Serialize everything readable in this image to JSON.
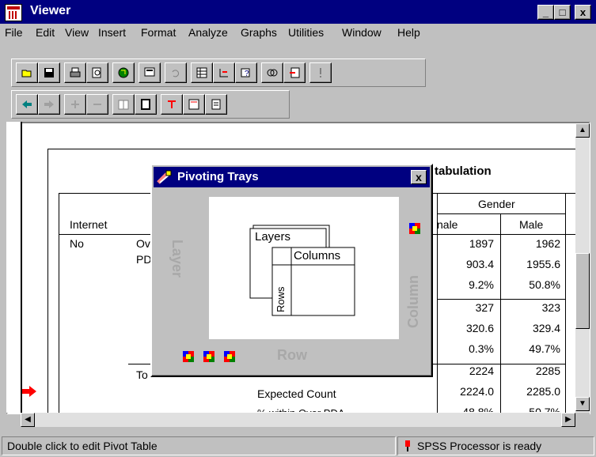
{
  "window": {
    "title": "Viewer",
    "minimize": "_",
    "maximize": "□",
    "close": "x"
  },
  "menu": [
    "File",
    "Edit",
    "View",
    "Insert",
    "Format",
    "Analyze",
    "Graphs",
    "Utilities",
    "Window",
    "Help"
  ],
  "table": {
    "title_partial": "tabulation",
    "header_gender": "Gender",
    "col_female_partial": "nale",
    "col_male": "Male",
    "row_var": "Internet",
    "row_no": "No",
    "row_sub1_a": "Ov",
    "row_sub1_b": "PD",
    "row_total_partial": "To",
    "expected_count": "Expected Count",
    "partial_row": "% within Over PDA",
    "female_values": [
      "1897",
      "903.4",
      "9.2%",
      "327",
      "320.6",
      "0.3%",
      "2224",
      "2224.0",
      "48.8%"
    ],
    "male_values": [
      "1962",
      "1955.6",
      "50.8%",
      "323",
      "329.4",
      "49.7%",
      "2285",
      "2285.0",
      "50.7%"
    ]
  },
  "pivot_dialog": {
    "title": "Pivoting Trays",
    "close": "x",
    "tray_layer": "Layer",
    "tray_column": "Column",
    "tray_row": "Row",
    "diagram_layers": "Layers",
    "diagram_columns": "Columns",
    "diagram_rows": "Rows"
  },
  "status": {
    "left": "Double click to edit Pivot Table",
    "right": "SPSS Processor  is ready"
  },
  "colors": {
    "titlebar": "#000080",
    "face": "#c0c0c0",
    "arrow": "#ff0000"
  }
}
